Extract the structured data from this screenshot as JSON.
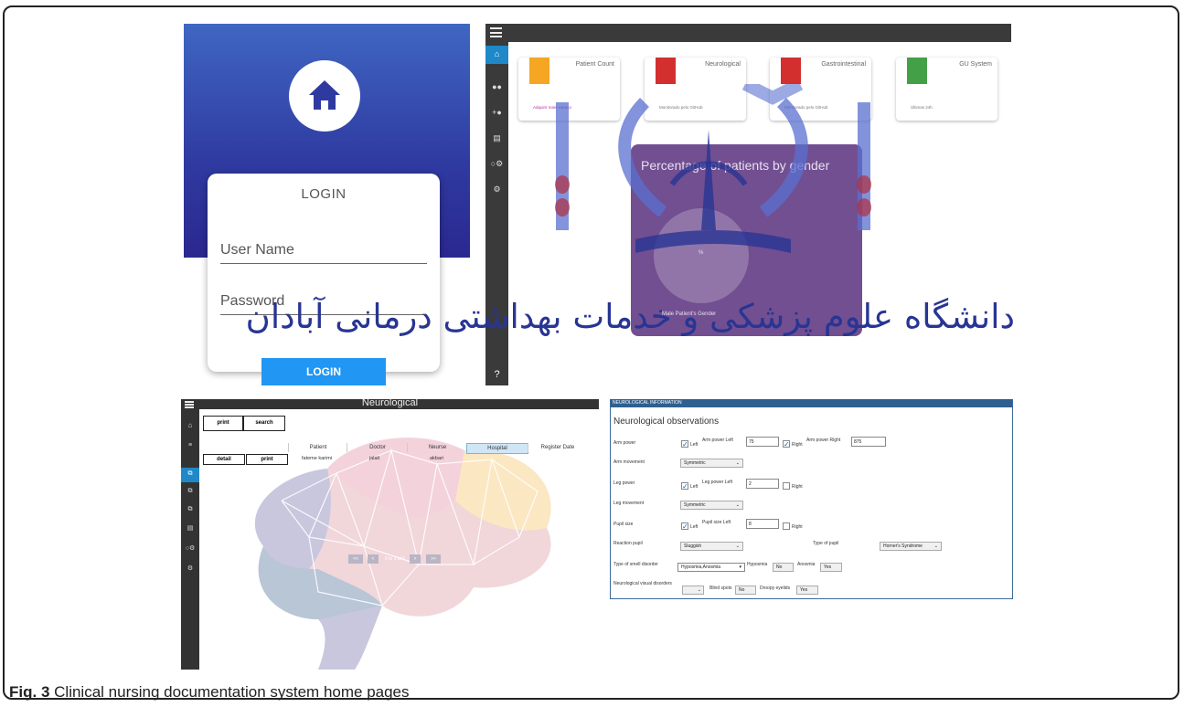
{
  "caption": {
    "fig": "Fig. 3",
    "text": "Clinical nursing documentation system home pages"
  },
  "login": {
    "title": "LOGIN",
    "username_placeholder": "User Name",
    "password_placeholder": "Password",
    "button": "LOGIN",
    "colors": {
      "hero_top": "#3f66c2",
      "hero_bottom": "#2a2890",
      "button": "#2196f3"
    }
  },
  "dashboard": {
    "cards": [
      {
        "title": "Patient Count",
        "footer": "Adquirir mais espaço",
        "color": "#f5a623",
        "icon": "copy-icon"
      },
      {
        "title": "Neurological",
        "footer": "Monitorado pelo GitHub",
        "color": "#d32f2f",
        "icon": "alert-icon"
      },
      {
        "title": "Gastrointestinal",
        "footer": "Monitorado pelo GitHub",
        "color": "#d32f2f",
        "icon": "alert-icon"
      },
      {
        "title": "GU System",
        "footer": "Últimas 24h",
        "color": "#43a047",
        "icon": "store-icon"
      }
    ],
    "chart_title": "Percentage of patients by gender",
    "chart_value": "%",
    "chart_legend": "Male Patient's Gender",
    "help": "?",
    "watermark_text": "دانشگاه علوم پزشکی و خدمات بهداشتی درمانی آبادان"
  },
  "neuro_list": {
    "title": "Neurological",
    "buttons": {
      "print": "print",
      "search": "search",
      "detail": "detail",
      "row_print": "print"
    },
    "columns": [
      "Patient",
      "Doctor",
      "Neurse",
      "Hospital",
      "Register Date"
    ],
    "row": {
      "patient": "fateme karimi",
      "doctor": "jalali",
      "nurse": "akbari"
    },
    "pager": {
      "first": "<<",
      "prev": "<",
      "info": "0 to 1 of 1",
      "next": ">",
      "last": ">>"
    }
  },
  "neuro_form": {
    "header": "NEUROLOGICAL INFORMATION",
    "heading": "Neurological observations",
    "arm_power": {
      "label": "Arm power",
      "left": "Left",
      "left_label": "Arm power Left",
      "left_value": "75",
      "right": "Right",
      "right_label": "Arm power Right",
      "right_value": "875"
    },
    "arm_movement": {
      "label": "Arm movement",
      "value": "Symmetric"
    },
    "leg_power": {
      "label": "Leg power",
      "left": "Left",
      "left_label": "Leg power Left",
      "left_value": "2",
      "right": "Right"
    },
    "leg_movement": {
      "label": "Leg movement",
      "value": "Symmetric"
    },
    "pupil_size": {
      "label": "Pupil size",
      "left": "Left",
      "left_label": "Pupil size Left",
      "left_value": "8",
      "right": "Right"
    },
    "reaction_pupil": {
      "label": "Reaction pupil",
      "value": "Sluggish"
    },
    "type_pupil": {
      "label": "Type of pupil",
      "value": "Horner's Syndrome"
    },
    "smell": {
      "label": "Type of smell disorder",
      "value": "Hyposmia,Anosmia",
      "hyposmia_label": "Hyposmia",
      "hyposmia_value": "No",
      "anosmia_label": "Anosmia",
      "anosmia_value": "Yes"
    },
    "visual": {
      "label": "Neurological visual disorders",
      "blind_label": "Blind spots",
      "blind_value": "No",
      "droopy_label": "Droopy eyelids",
      "droopy_value": "Yes"
    }
  }
}
